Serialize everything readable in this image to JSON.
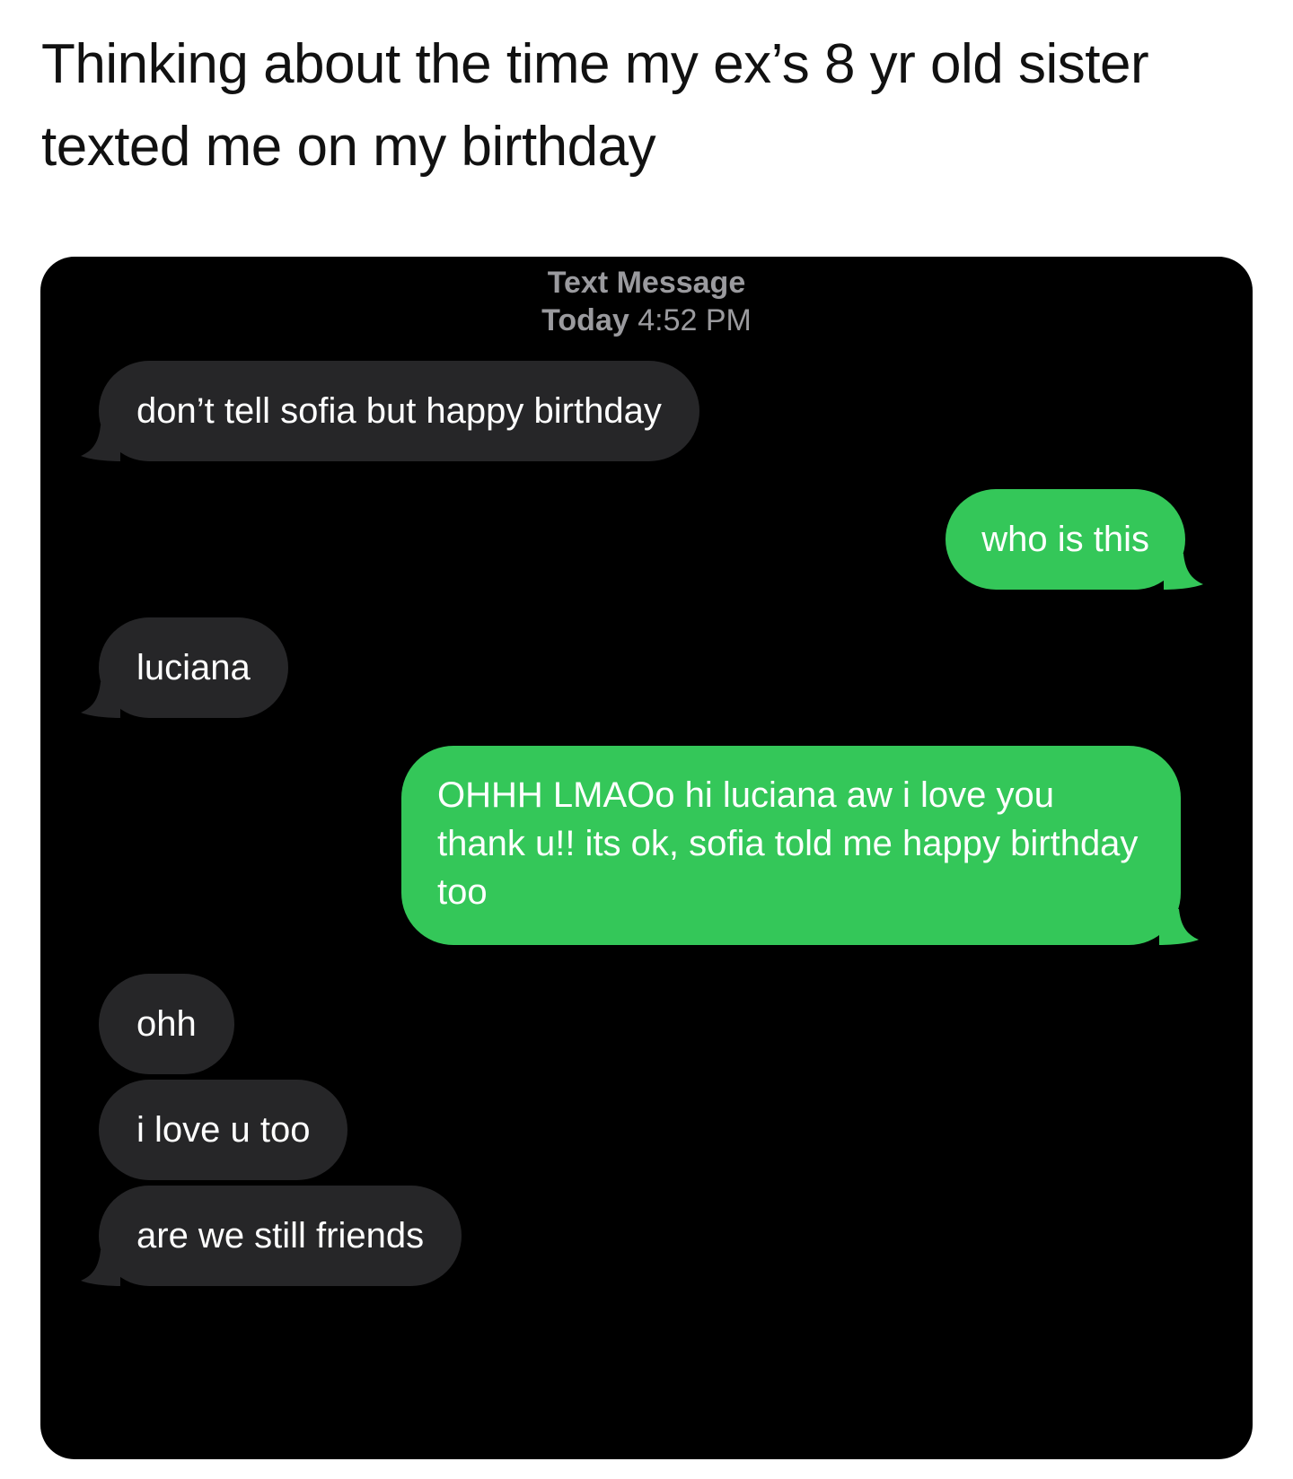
{
  "post": {
    "caption": "Thinking about the time my ex’s 8 yr old sister texted me on my birthday"
  },
  "thread": {
    "service_label": "Text Message",
    "day_label": "Today",
    "time_label": "4:52 PM"
  },
  "colors": {
    "screen_bg": "#000000",
    "received_bubble": "#262628",
    "sent_bubble": "#34c759",
    "header_text": "#9a9a9e"
  },
  "messages": [
    {
      "direction": "received",
      "text": "don’t tell sofia but happy birthday"
    },
    {
      "direction": "sent",
      "text": "who is this"
    },
    {
      "direction": "received",
      "text": "luciana"
    },
    {
      "direction": "sent",
      "text": "OHHH LMAOo hi luciana aw i love you thank u!! its ok, sofia told me happy birthday too"
    },
    {
      "direction": "received",
      "text": "ohh"
    },
    {
      "direction": "received",
      "text": "i love u too"
    },
    {
      "direction": "received",
      "text": "are we still friends"
    }
  ]
}
